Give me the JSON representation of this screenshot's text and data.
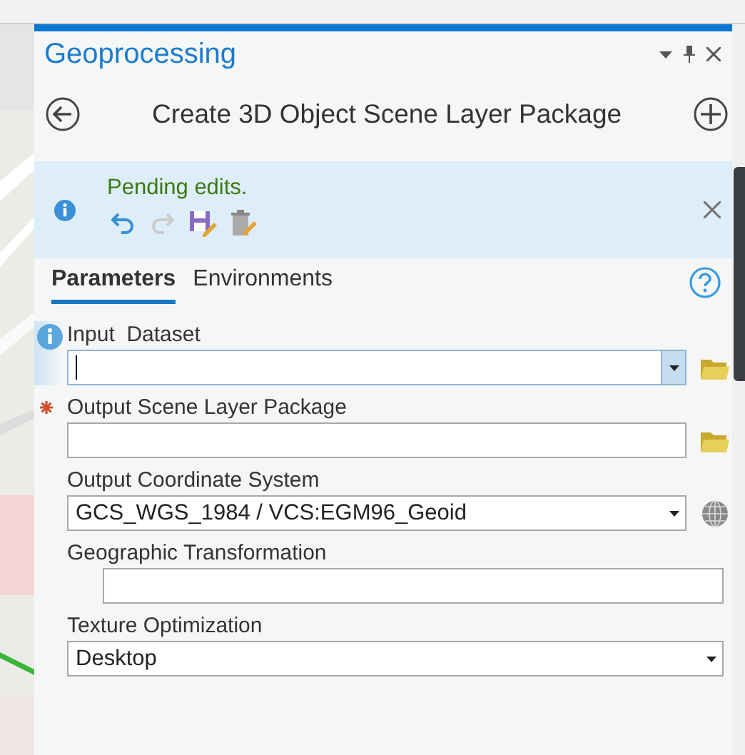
{
  "panel": {
    "title": "Geoprocessing"
  },
  "tool": {
    "title": "Create 3D Object Scene Layer Package"
  },
  "message": {
    "text": "Pending edits.",
    "actions": [
      {
        "kind": "undo",
        "disabled": false
      },
      {
        "kind": "redo",
        "disabled": true
      },
      {
        "kind": "save",
        "disabled": false
      },
      {
        "kind": "discard",
        "disabled": false
      }
    ]
  },
  "tabs": [
    {
      "label": "Parameters",
      "selected": true
    },
    {
      "label": "Environments",
      "selected": false
    }
  ],
  "parameters": [
    {
      "label": "Input  Dataset",
      "kind": "dropdown",
      "info": true,
      "required": false,
      "focused": true,
      "indented": false,
      "browse_button": true,
      "coordinate_button": false
    },
    {
      "label": "Output Scene Layer Package",
      "kind": "text",
      "info": false,
      "required": true,
      "focused": false,
      "indented": false,
      "browse_button": true,
      "coordinate_button": false
    },
    {
      "label": "Output Coordinate System",
      "kind": "dropdown",
      "value": "GCS_WGS_1984 / VCS:EGM96_Geoid",
      "info": false,
      "required": false,
      "focused": false,
      "indented": false,
      "browse_button": false,
      "coordinate_button": true
    },
    {
      "label": "Geographic Transformation",
      "kind": "text",
      "info": false,
      "required": false,
      "focused": false,
      "indented": true,
      "browse_button": false,
      "coordinate_button": false
    },
    {
      "label": "Texture Optimization",
      "kind": "dropdown",
      "value": "Desktop",
      "info": false,
      "required": false,
      "focused": false,
      "indented": false,
      "browse_button": false,
      "coordinate_button": false
    }
  ]
}
